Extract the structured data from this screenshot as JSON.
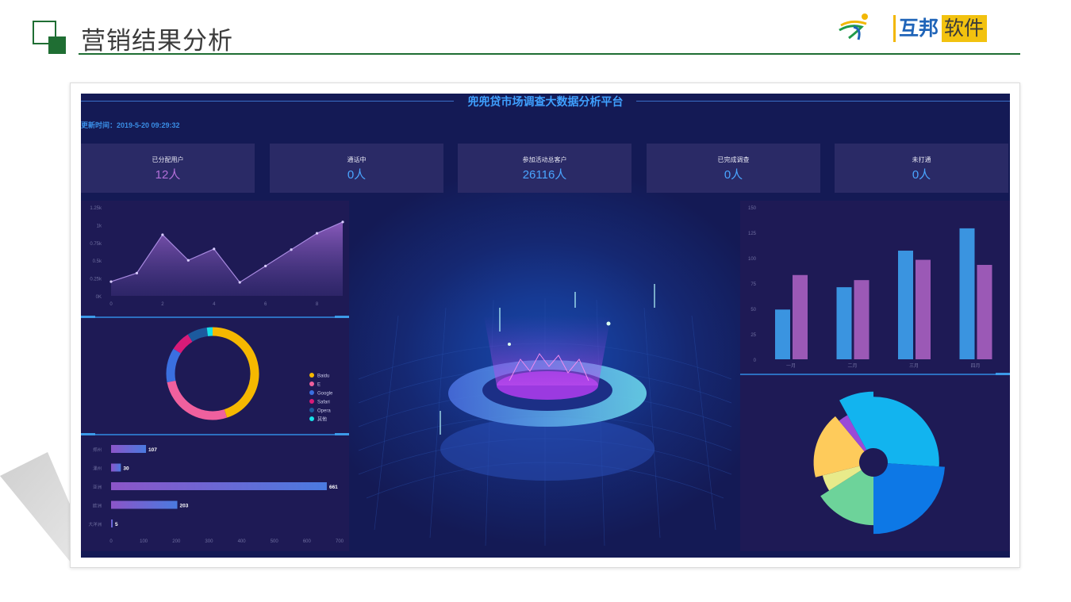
{
  "slide": {
    "title": "营销结果分析",
    "logo": {
      "brand_a": "互邦",
      "brand_b": "软件"
    },
    "colors": {
      "brand_green": "#1f6e33",
      "logo_blue": "#1f64b8",
      "logo_yellow": "#f2c20f"
    }
  },
  "dashboard": {
    "title": "兜兜贷市场调查大数据分析平台",
    "update_time": "更新时间：2019-5-20 09:29:32",
    "kpis": [
      {
        "label": "已分配用户",
        "value": "12人",
        "color": "#b26fd8"
      },
      {
        "label": "通话中",
        "value": "0人",
        "color": "#4aa5ff"
      },
      {
        "label": "参加活动总客户",
        "value": "26116人",
        "color": "#4aa5ff"
      },
      {
        "label": "已完成调查",
        "value": "0人",
        "color": "#4aa5ff"
      },
      {
        "label": "未打通",
        "value": "0人",
        "color": "#4aa5ff"
      }
    ]
  },
  "chart_data": [
    {
      "type": "area",
      "x": [
        0,
        1,
        2,
        3,
        4,
        5,
        6,
        7,
        8,
        9
      ],
      "values": [
        200,
        320,
        860,
        500,
        660,
        190,
        420,
        650,
        880,
        1040
      ],
      "xticks": [
        "0",
        "2",
        "4",
        "6",
        "8"
      ],
      "yticks": [
        "0K",
        "0.25k",
        "0.5k",
        "0.75k",
        "1k",
        "1.25k"
      ],
      "ylim": [
        0,
        1250
      ],
      "color": "#8e5dc0"
    },
    {
      "type": "pie",
      "donut": true,
      "slices": [
        {
          "name": "Baidu",
          "value": 45,
          "color": "#f5b800"
        },
        {
          "name": "E",
          "value": 27,
          "color": "#f0609e"
        },
        {
          "name": "Google",
          "value": 12,
          "color": "#3a6fe0"
        },
        {
          "name": "Safari",
          "value": 7,
          "color": "#d81b78"
        },
        {
          "name": "Opera",
          "value": 7,
          "color": "#1c5a9e"
        },
        {
          "name": "其他",
          "value": 2,
          "color": "#18e0e8"
        }
      ],
      "legend": "right"
    },
    {
      "type": "bar",
      "orientation": "horizontal",
      "categories": [
        "郑州",
        "漯州",
        "亚洲",
        "欧洲",
        "大洋洲"
      ],
      "values": [
        107,
        30,
        661,
        203,
        5
      ],
      "xticks": [
        "0",
        "100",
        "200",
        "300",
        "400",
        "500",
        "600",
        "700"
      ],
      "xlim": [
        0,
        700
      ]
    },
    {
      "type": "bar",
      "categories": [
        "一月",
        "二月",
        "三月",
        "四月"
      ],
      "series": [
        {
          "values": [
            49,
            71,
            107,
            129
          ],
          "color": "#3a94e0"
        },
        {
          "values": [
            83,
            78,
            98,
            93
          ],
          "color": "#9b59b6"
        }
      ],
      "yticks": [
        "0",
        "25",
        "50",
        "75",
        "100",
        "125",
        "150"
      ],
      "ylim": [
        0,
        150
      ]
    },
    {
      "type": "pie",
      "rose": true,
      "slices": [
        {
          "value": 26,
          "radius": 0.9,
          "color": "#12b4ef"
        },
        {
          "value": 24,
          "radius": 0.98,
          "color": "#0d78e6"
        },
        {
          "value": 16,
          "radius": 0.86,
          "color": "#6dd39a"
        },
        {
          "value": 5,
          "radius": 0.72,
          "color": "#e8ea8a"
        },
        {
          "value": 18,
          "radius": 0.82,
          "color": "#fecb5b"
        },
        {
          "value": 3,
          "radius": 0.74,
          "color": "#9a4ad8"
        },
        {
          "value": 8,
          "radius": 0.97,
          "color": "#12b4ef"
        }
      ]
    }
  ]
}
